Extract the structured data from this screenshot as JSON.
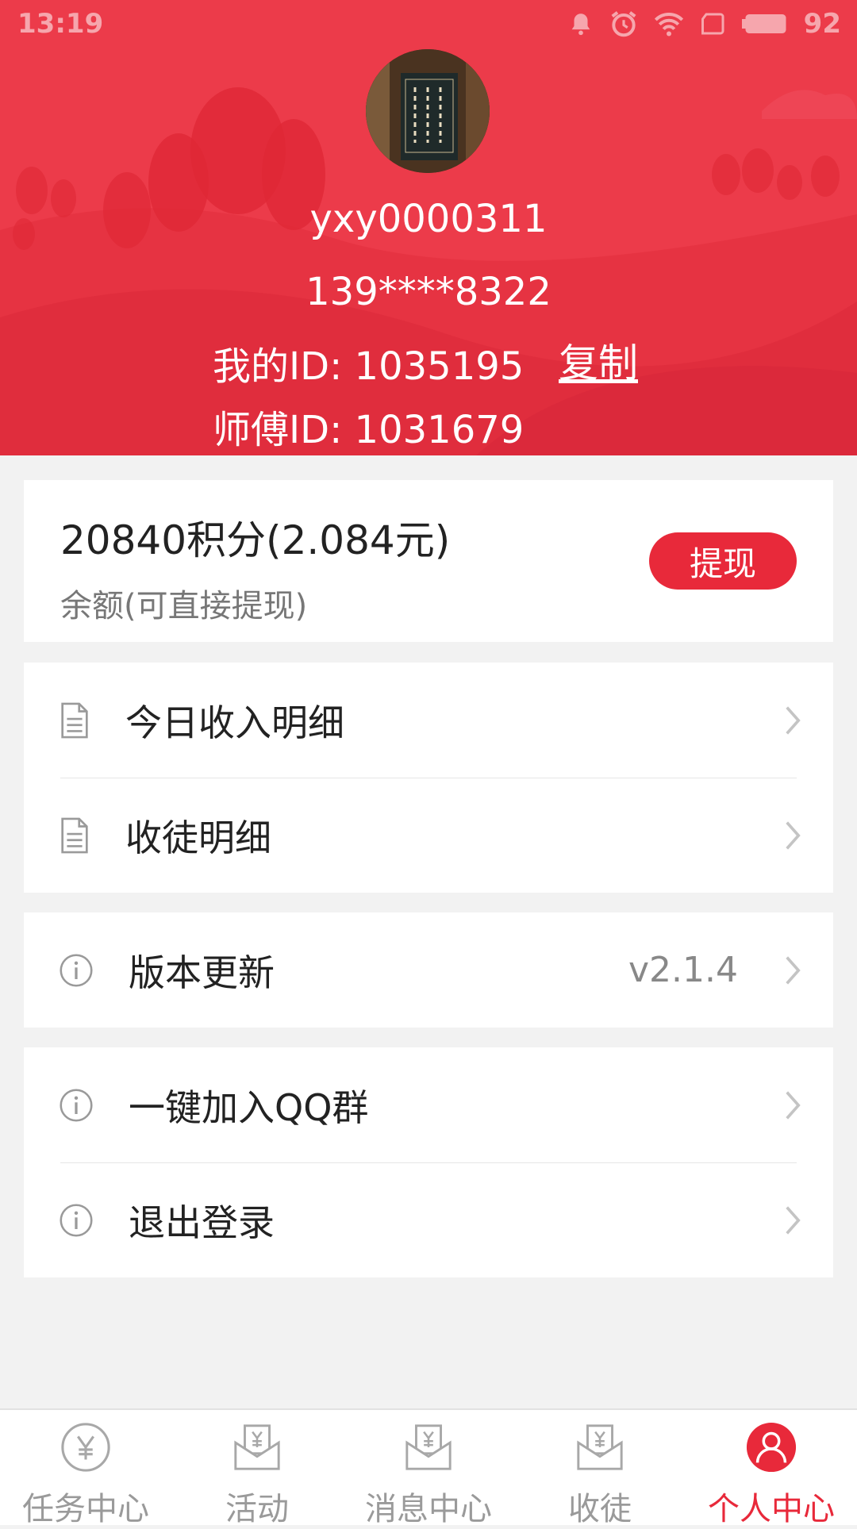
{
  "status_bar": {
    "time": "13:19",
    "battery": "92"
  },
  "profile": {
    "username": "yxy0000311",
    "phone": "139****8322",
    "my_id_label": "我的ID: 1035195",
    "copy_label": "复制",
    "master_id_label": "师傅ID: 1031679"
  },
  "balance": {
    "points_text": "20840积分(2.084元)",
    "sub_text": "余额(可直接提现)",
    "withdraw_label": "提现"
  },
  "menu": {
    "today_income": "今日收入明细",
    "disciple_detail": "收徒明细",
    "version_update": "版本更新",
    "version_value": "v2.1.4",
    "join_qq": "一键加入QQ群",
    "logout": "退出登录"
  },
  "tabs": [
    {
      "label": "任务中心",
      "icon": "yen-circle-icon"
    },
    {
      "label": "活动",
      "icon": "envelope-yen-icon"
    },
    {
      "label": "消息中心",
      "icon": "envelope-yen-icon"
    },
    {
      "label": "收徒",
      "icon": "envelope-yen-icon"
    },
    {
      "label": "个人中心",
      "icon": "user-icon",
      "active": true
    }
  ],
  "colors": {
    "header_red": "#ec3b4a",
    "accent_red": "#e8293a",
    "bg_gray": "#f2f2f2"
  }
}
